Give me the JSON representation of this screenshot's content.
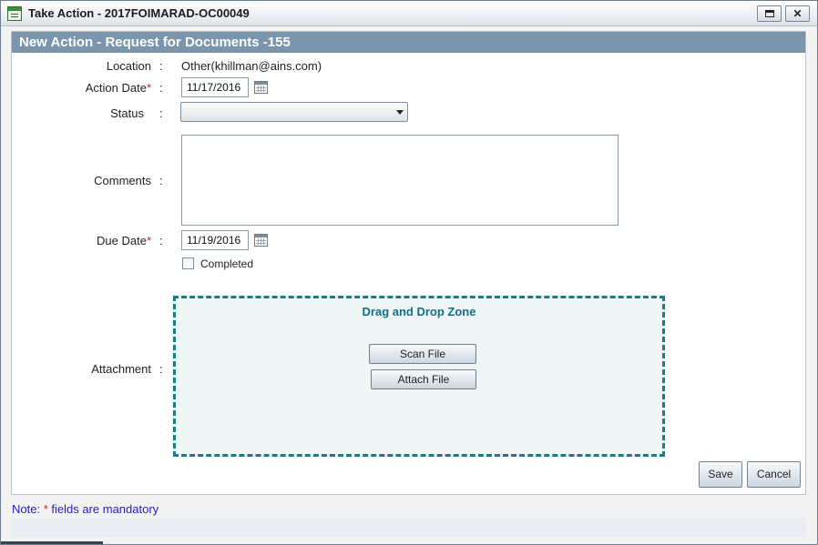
{
  "window": {
    "title": "Take Action - 2017FOIMARAD-OC00049"
  },
  "panel": {
    "title": "New Action - Request for Documents -155"
  },
  "form": {
    "location": {
      "label": "Location",
      "colon": ":",
      "value": "Other(khillman@ains.com)"
    },
    "action_date": {
      "label": "Action Date",
      "required_mark": "*",
      "colon": ":",
      "value": "11/17/2016"
    },
    "status": {
      "label": "Status",
      "colon": ":",
      "value": ""
    },
    "comments": {
      "label": "Comments",
      "colon": ":",
      "value": ""
    },
    "due_date": {
      "label": "Due Date",
      "required_mark": "*",
      "colon": ":",
      "value": "11/19/2016"
    },
    "completed": {
      "label": "Completed",
      "checked": false
    },
    "attachment": {
      "label": "Attachment",
      "colon": ":",
      "dropzone_title": "Drag and Drop Zone",
      "scan_button": "Scan File",
      "attach_button": "Attach File"
    }
  },
  "actions": {
    "save": "Save",
    "cancel": "Cancel"
  },
  "note": {
    "prefix": "Note:",
    "mark": "*",
    "suffix": "fields are mandatory"
  },
  "icons": {
    "app": "form-icon",
    "maximize": "maximize-icon",
    "close": "close-icon",
    "calendar": "calendar-icon",
    "dropdown": "chevron-down-icon"
  },
  "colors": {
    "header": "#7a95ac",
    "dropzone_border": "#0f7f8c",
    "required": "#d42020",
    "note": "#1f1fbf"
  }
}
